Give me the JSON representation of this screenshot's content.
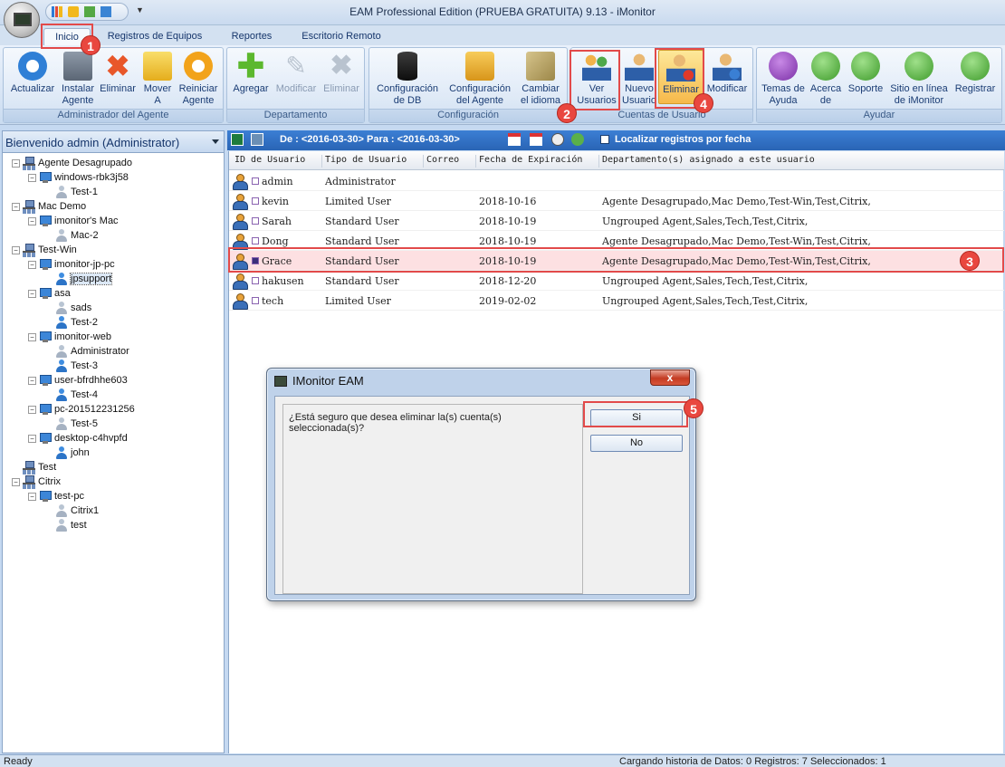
{
  "window": {
    "title": "EAM Professional Edition (PRUEBA GRATUITA) 9.13 - iMonitor"
  },
  "tabs": [
    {
      "label": "Inicio"
    },
    {
      "label": "Registros de Equipos"
    },
    {
      "label": "Reportes"
    },
    {
      "label": "Escritorio Remoto"
    }
  ],
  "ribbon": {
    "groups": {
      "agente": "Administrador del Agente",
      "departamento": "Departamento",
      "configuracion": "Configuración",
      "cuentas": "Cuentas de Usuario",
      "ayudar": "Ayudar"
    },
    "buttons": {
      "actualizar": [
        "Actualizar",
        ""
      ],
      "instalar": [
        "Instalar",
        "Agente"
      ],
      "eliminar_agente": [
        "Eliminar",
        ""
      ],
      "mover": [
        "Mover",
        "A"
      ],
      "reiniciar": [
        "Reiniciar",
        "Agente"
      ],
      "agregar": [
        "Agregar",
        ""
      ],
      "modificar_dep": [
        "Modificar",
        ""
      ],
      "eliminar_dep": [
        "Eliminar",
        ""
      ],
      "config_db": [
        "Configuración",
        "de DB"
      ],
      "config_agente": [
        "Configuración",
        "del Agente"
      ],
      "idioma": [
        "Cambiar",
        "el idioma"
      ],
      "ver_usuarios": [
        "Ver",
        "Usuarios"
      ],
      "nuevo_usuario": [
        "Nuevo",
        "Usuario"
      ],
      "eliminar_usuario": [
        "Eliminar",
        ""
      ],
      "modificar_usuario": [
        "Modificar",
        ""
      ],
      "temas": [
        "Temas de",
        "Ayuda"
      ],
      "acerca": [
        "Acerca",
        "de"
      ],
      "soporte": [
        "Soporte",
        ""
      ],
      "sitio": [
        "Sitio en línea",
        "de iMonitor"
      ],
      "registrar": [
        "Registrar",
        ""
      ]
    }
  },
  "left_panel": {
    "header": "Bienvenido admin (Administrator)",
    "tree": [
      {
        "label": "Agente Desagrupado",
        "type": "net",
        "level": 0,
        "expander": "−"
      },
      {
        "label": "windows-rbk3j58",
        "type": "pc",
        "level": 1,
        "expander": "−"
      },
      {
        "label": "Test-1",
        "type": "user",
        "level": 2
      },
      {
        "label": "Mac Demo",
        "type": "net",
        "level": 0,
        "expander": "−"
      },
      {
        "label": "imonitor's Mac",
        "type": "pc",
        "level": 1,
        "expander": "−"
      },
      {
        "label": "Mac-2",
        "type": "user",
        "level": 2
      },
      {
        "label": "Test-Win",
        "type": "net",
        "level": 0,
        "expander": "−"
      },
      {
        "label": "imonitor-jp-pc",
        "type": "pc",
        "level": 1,
        "expander": "−"
      },
      {
        "label": "jpsupport",
        "type": "user-blue",
        "level": 2,
        "selected": true
      },
      {
        "label": "asa",
        "type": "pc",
        "level": 1,
        "expander": "−"
      },
      {
        "label": "sads",
        "type": "user",
        "level": 2
      },
      {
        "label": "Test-2",
        "type": "user-blue",
        "level": 2
      },
      {
        "label": "imonitor-web",
        "type": "pc",
        "level": 1,
        "expander": "−"
      },
      {
        "label": "Administrator",
        "type": "user",
        "level": 2
      },
      {
        "label": "Test-3",
        "type": "user-blue",
        "level": 2
      },
      {
        "label": "user-bfrdhhe603",
        "type": "pc",
        "level": 1,
        "expander": "−"
      },
      {
        "label": "Test-4",
        "type": "user-blue",
        "level": 2
      },
      {
        "label": "pc-201512231256",
        "type": "pc",
        "level": 1,
        "expander": "−"
      },
      {
        "label": "Test-5",
        "type": "user",
        "level": 2
      },
      {
        "label": "desktop-c4hvpfd",
        "type": "pc",
        "level": 1,
        "expander": "−"
      },
      {
        "label": "john",
        "type": "user-blue",
        "level": 2
      },
      {
        "label": "Test",
        "type": "net",
        "level": 0
      },
      {
        "label": "Citrix",
        "type": "net",
        "level": 0,
        "expander": "−"
      },
      {
        "label": "test-pc",
        "type": "pc",
        "level": 1,
        "expander": "−"
      },
      {
        "label": "Citrix1",
        "type": "user",
        "level": 2
      },
      {
        "label": "test",
        "type": "user",
        "level": 2
      }
    ]
  },
  "toolbar": {
    "date_range": "De : <2016-03-30> Para : <2016-03-30>",
    "locate_by_date": "Localizar registros por fecha"
  },
  "grid": {
    "columns": [
      "ID de Usuario",
      "Tipo de Usuario",
      "Correo",
      "Fecha de Expiración",
      "Departamento(s) asignado a este usuario"
    ],
    "rows": [
      {
        "id": "admin",
        "type": "Administrator",
        "email": "",
        "exp": "",
        "dept": ""
      },
      {
        "id": "kevin",
        "type": "Limited User",
        "email": "",
        "exp": "2018-10-16",
        "dept": "Agente Desagrupado,Mac Demo,Test-Win,Test,Citrix,"
      },
      {
        "id": "Sarah",
        "type": "Standard User",
        "email": "",
        "exp": "2018-10-19",
        "dept": "Ungrouped Agent,Sales,Tech,Test,Citrix,"
      },
      {
        "id": "Dong",
        "type": "Standard User",
        "email": "",
        "exp": "2018-10-19",
        "dept": "Agente Desagrupado,Mac Demo,Test-Win,Test,Citrix,"
      },
      {
        "id": "Grace",
        "type": "Standard User",
        "email": "",
        "exp": "2018-10-19",
        "dept": "Agente Desagrupado,Mac Demo,Test-Win,Test,Citrix,",
        "selected": true
      },
      {
        "id": "hakusen",
        "type": "Standard User",
        "email": "",
        "exp": "2018-12-20",
        "dept": "Ungrouped Agent,Sales,Tech,Test,Citrix,"
      },
      {
        "id": "tech",
        "type": "Limited User",
        "email": "",
        "exp": "2019-02-02",
        "dept": "Ungrouped Agent,Sales,Tech,Test,Citrix,"
      }
    ]
  },
  "dialog": {
    "title": "IMonitor EAM",
    "message": "¿Está seguro que desea eliminar la(s) cuenta(s) seleccionada(s)?",
    "yes": "Si",
    "no": "No",
    "close": "x"
  },
  "status": {
    "left": "Ready",
    "right": "Cargando historia de Datos: 0 Registros: 7 Seleccionados: 1"
  },
  "steps": [
    "1",
    "2",
    "3",
    "4",
    "5"
  ],
  "colors": {
    "highlight": "#e24a4a",
    "selected_row": "#fde0e2",
    "toolbar": "#2964b5"
  }
}
